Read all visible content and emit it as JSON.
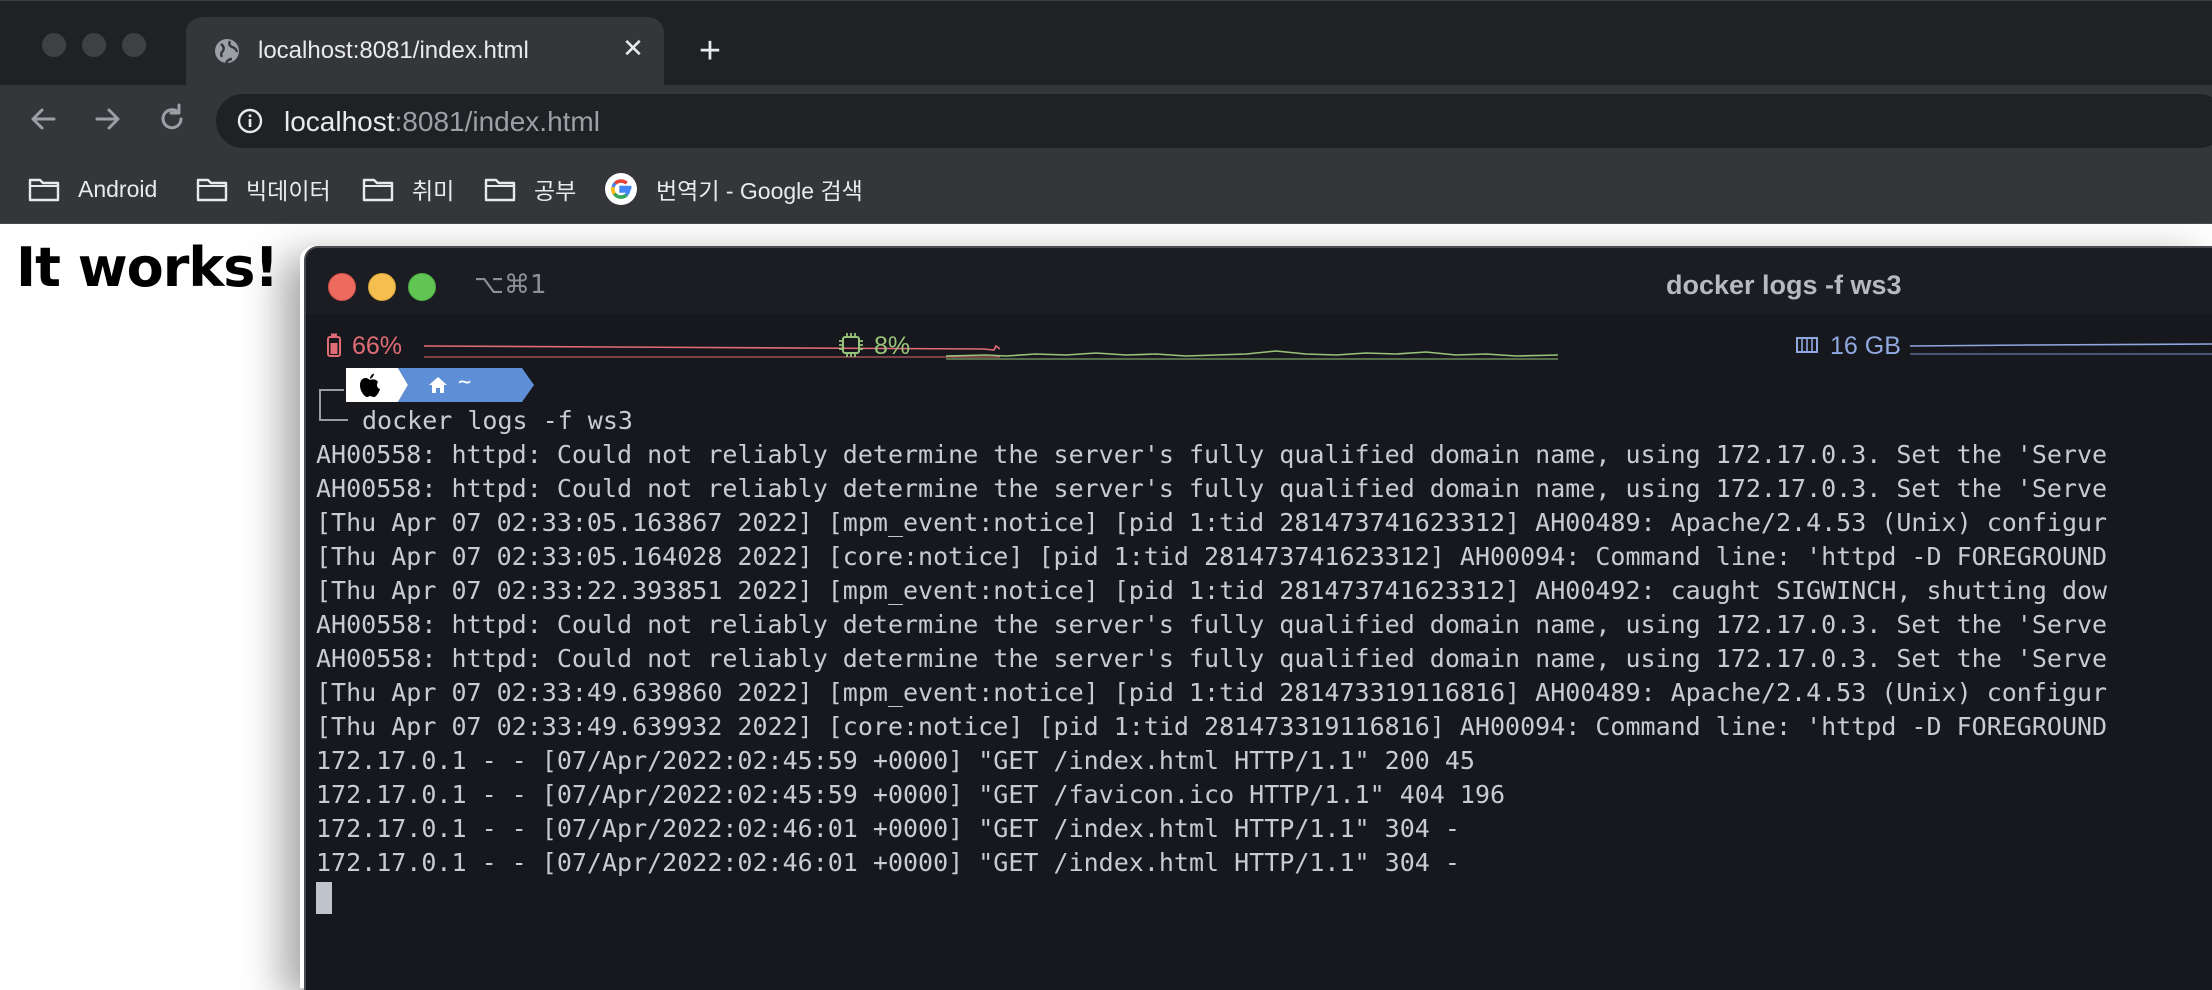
{
  "browser": {
    "tab": {
      "title": "localhost:8081/index.html",
      "close_icon": "close-icon",
      "favicon": "globe-icon"
    },
    "new_tab_icon": "plus-icon",
    "nav": {
      "back_icon": "arrow-left-icon",
      "forward_icon": "arrow-right-icon",
      "reload_icon": "reload-icon"
    },
    "address": {
      "host": "localhost",
      "rest": ":8081/index.html",
      "info_icon": "info-icon"
    },
    "bookmarks": [
      {
        "label": "Android",
        "icon": "folder-icon"
      },
      {
        "label": "빅데이터",
        "icon": "folder-icon"
      },
      {
        "label": "취미",
        "icon": "folder-icon"
      },
      {
        "label": "공부",
        "icon": "folder-icon"
      },
      {
        "label": "번역기 - Google 검색",
        "icon": "google-icon"
      }
    ]
  },
  "page": {
    "heading": "It works!"
  },
  "terminal": {
    "shortcut": "⌥⌘1",
    "title": "docker logs -f ws3",
    "stats": {
      "battery": {
        "value": "66%",
        "color": "#e06c75"
      },
      "cpu": {
        "value": "8%",
        "color": "#98c379"
      },
      "memory": {
        "value": "16 GB",
        "color": "#8fa8e0"
      }
    },
    "prompt": {
      "apple_icon": "apple-icon",
      "home_icon": "home-icon",
      "path": "~",
      "accent": "#5e8fd6"
    },
    "command": "docker logs -f ws3",
    "lines": [
      "AH00558: httpd: Could not reliably determine the server's fully qualified domain name, using 172.17.0.3. Set the 'Serve",
      "AH00558: httpd: Could not reliably determine the server's fully qualified domain name, using 172.17.0.3. Set the 'Serve",
      "[Thu Apr 07 02:33:05.163867 2022] [mpm_event:notice] [pid 1:tid 281473741623312] AH00489: Apache/2.4.53 (Unix) configur",
      "[Thu Apr 07 02:33:05.164028 2022] [core:notice] [pid 1:tid 281473741623312] AH00094: Command line: 'httpd -D FOREGROUND",
      "[Thu Apr 07 02:33:22.393851 2022] [mpm_event:notice] [pid 1:tid 281473741623312] AH00492: caught SIGWINCH, shutting dow",
      "AH00558: httpd: Could not reliably determine the server's fully qualified domain name, using 172.17.0.3. Set the 'Serve",
      "AH00558: httpd: Could not reliably determine the server's fully qualified domain name, using 172.17.0.3. Set the 'Serve",
      "[Thu Apr 07 02:33:49.639860 2022] [mpm_event:notice] [pid 1:tid 281473319116816] AH00489: Apache/2.4.53 (Unix) configur",
      "[Thu Apr 07 02:33:49.639932 2022] [core:notice] [pid 1:tid 281473319116816] AH00094: Command line: 'httpd -D FOREGROUND",
      "172.17.0.1 - - [07/Apr/2022:02:45:59 +0000] \"GET /index.html HTTP/1.1\" 200 45",
      "172.17.0.1 - - [07/Apr/2022:02:45:59 +0000] \"GET /favicon.ico HTTP/1.1\" 404 196",
      "172.17.0.1 - - [07/Apr/2022:02:46:01 +0000] \"GET /index.html HTTP/1.1\" 304 -",
      "172.17.0.1 - - [07/Apr/2022:02:46:01 +0000] \"GET /index.html HTTP/1.1\" 304 -"
    ]
  }
}
